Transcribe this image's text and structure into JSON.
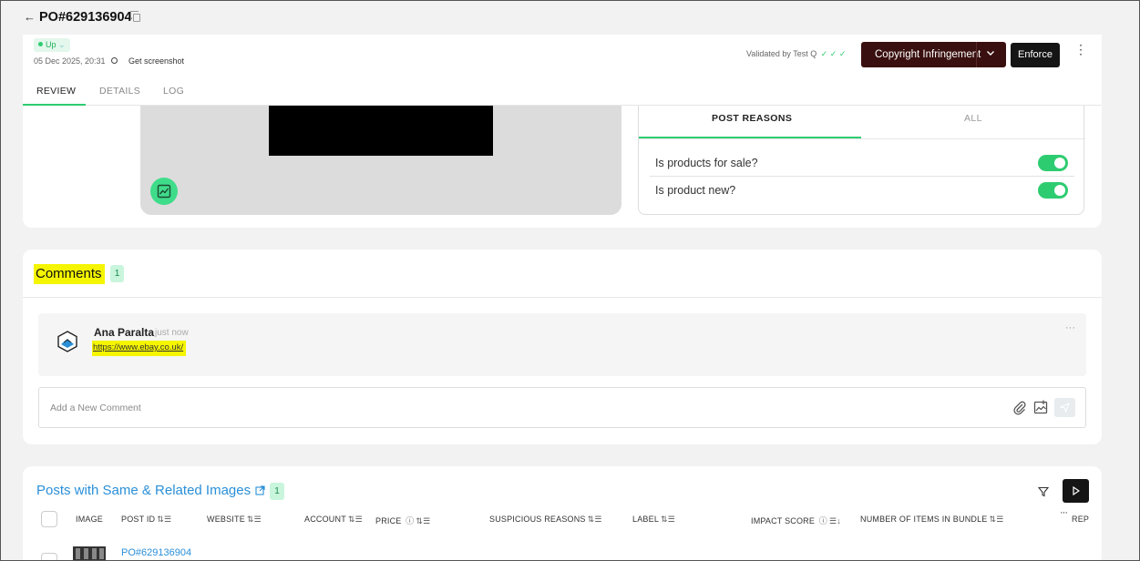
{
  "top": {
    "back_arrow": "←",
    "title": "PO#629136904"
  },
  "header": {
    "status": "Up",
    "status_caret": "⌄",
    "datetime": "05 Dec 2025, 20:31",
    "screenshot_label": "Get screenshot",
    "validated_by": "Validated by Test Q",
    "validated_checks": "✓ ✓ ✓",
    "classification_button": "Copyright Infringement",
    "enforce_button": "Enforce",
    "more_menu": "⋮",
    "tabs": [
      {
        "label": "REVIEW",
        "active": true
      },
      {
        "label": "DETAILS",
        "active": false
      },
      {
        "label": "LOG",
        "active": false
      }
    ]
  },
  "reasons": {
    "tabs": [
      "POST REASONS",
      "ALL"
    ],
    "questions": [
      {
        "label": "Is products for sale?",
        "on": true
      },
      {
        "label": "Is product new?",
        "on": true
      }
    ]
  },
  "comments": {
    "title": "Comments",
    "count": "1",
    "items": [
      {
        "author": "Ana Paralta",
        "time": "just now",
        "text": "https://www.ebay.co.uk/",
        "more": "···"
      }
    ],
    "new_comment_placeholder": "Add a New Comment"
  },
  "related_posts": {
    "title": "Posts with Same & Related Images",
    "count": "1",
    "columns": [
      "IMAGE",
      "POST ID",
      "WEBSITE",
      "ACCOUNT",
      "PRICE",
      "SUSPICIOUS REASONS",
      "LABEL",
      "IMPACT SCORE",
      "NUMBER OF ITEMS IN BUNDLE",
      "REP"
    ],
    "rows": [
      {
        "post_id": "PO#629136904"
      }
    ],
    "more_columns": "···"
  },
  "colors": {
    "accent": "#2ecc71",
    "primary_dark": "#3a0f0f",
    "link": "#2a8fd8",
    "highlight": "#f5f500"
  }
}
